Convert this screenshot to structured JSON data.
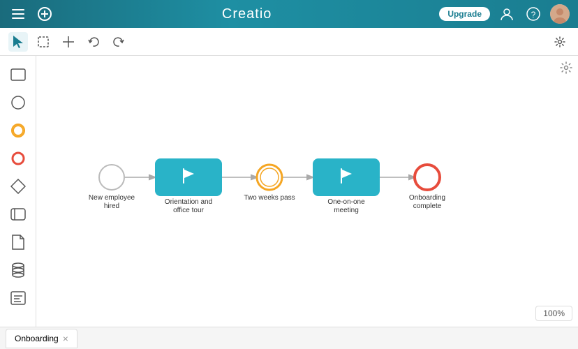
{
  "app": {
    "logo": "Creatio",
    "upgrade_label": "Upgrade"
  },
  "topnav": {
    "menu_icon": "☰",
    "add_icon": "⊕",
    "upgrade_label": "Upgrade",
    "user_icon": "👤",
    "help_icon": "?",
    "avatar_icon": "👤"
  },
  "toolbar": {
    "select_tool": "▶",
    "marquee_tool": "⬚",
    "hand_tool": "✛",
    "undo_tool": "↩",
    "redo_tool": "↪",
    "settings_tool": "⚙"
  },
  "sidebar": {
    "shapes": [
      {
        "name": "rectangle",
        "icon": "□"
      },
      {
        "name": "circle-thin",
        "icon": "○"
      },
      {
        "name": "circle-medium",
        "icon": "◯"
      },
      {
        "name": "circle-red",
        "icon": "◎"
      },
      {
        "name": "diamond",
        "icon": "◇"
      },
      {
        "name": "rectangle-rounded",
        "icon": "▭"
      },
      {
        "name": "document",
        "icon": "🗋"
      },
      {
        "name": "cylinder",
        "icon": "⊕"
      },
      {
        "name": "text",
        "icon": "[T]"
      }
    ]
  },
  "flow": {
    "nodes": [
      {
        "id": "start",
        "type": "start",
        "label": "New employee hired"
      },
      {
        "id": "task1",
        "type": "task",
        "label": "Orientation and office tour"
      },
      {
        "id": "inter1",
        "type": "intermediate",
        "label": "Two weeks pass"
      },
      {
        "id": "task2",
        "type": "task",
        "label": "One-on-one meeting"
      },
      {
        "id": "end",
        "type": "end",
        "label": "Onboarding complete"
      }
    ]
  },
  "zoom": {
    "level": "100%"
  },
  "tabs": [
    {
      "label": "Onboarding",
      "closable": true
    }
  ],
  "colors": {
    "teal": "#29b3c8",
    "orange": "#f5a623",
    "red": "#e74c3c",
    "nav_bg": "#1a7d90"
  }
}
